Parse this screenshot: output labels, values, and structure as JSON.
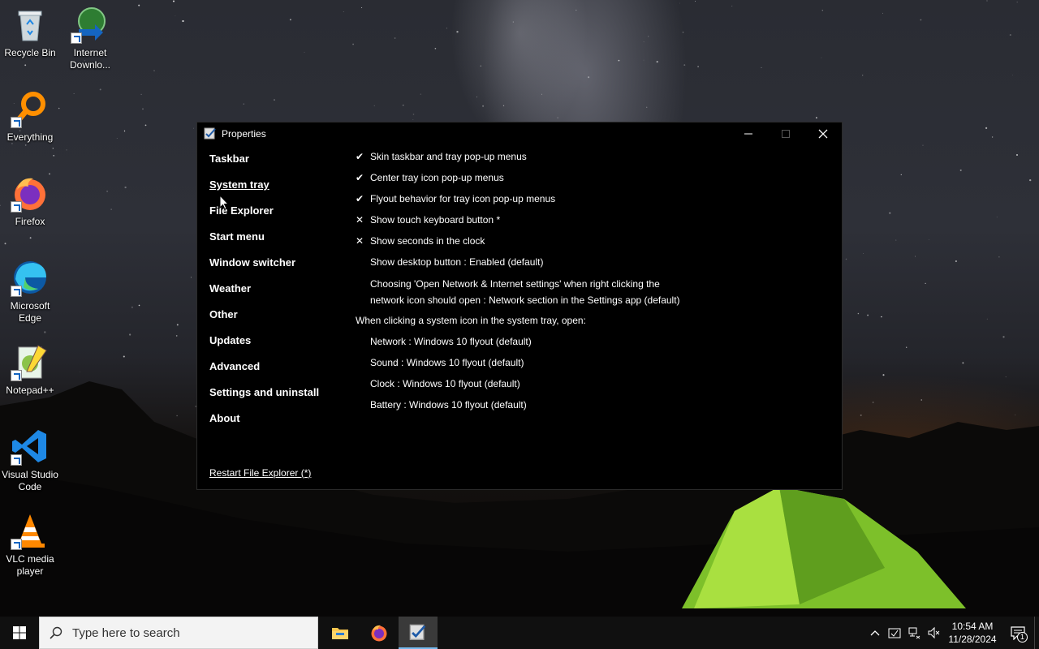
{
  "desktop": {
    "icons": [
      {
        "label": "Recycle Bin",
        "icon": "recycle-bin-icon"
      },
      {
        "label": "Internet Downlo...",
        "icon": "internet-download-manager-icon"
      },
      {
        "label": "Everything",
        "icon": "everything-search-icon"
      },
      {
        "label": "Firefox",
        "icon": "firefox-icon"
      },
      {
        "label": "Microsoft Edge",
        "icon": "edge-icon"
      },
      {
        "label": "Notepad++",
        "icon": "notepad-plus-plus-icon"
      },
      {
        "label": "Visual Studio Code",
        "icon": "vscode-icon"
      },
      {
        "label": "VLC media player",
        "icon": "vlc-icon"
      }
    ]
  },
  "window": {
    "title": "Properties",
    "controls": {
      "minimize": "—",
      "maximize": "☐",
      "close": "✕"
    },
    "nav": [
      "Taskbar",
      "System tray",
      "File Explorer",
      "Start menu",
      "Window switcher",
      "Weather",
      "Other",
      "Updates",
      "Advanced",
      "Settings and uninstall",
      "About"
    ],
    "active_nav": "System tray",
    "restart_link": "Restart File Explorer (*)",
    "settings": [
      {
        "mark": "✔",
        "text": "Skin taskbar and tray pop-up menus"
      },
      {
        "mark": "✔",
        "text": "Center tray icon pop-up menus"
      },
      {
        "mark": "✔",
        "text": "Flyout behavior for tray icon pop-up menus"
      },
      {
        "mark": "✕",
        "text": "Show touch keyboard button *"
      },
      {
        "mark": "✕",
        "text": "Show seconds in the clock"
      },
      {
        "mark": "",
        "text": "Show desktop button : Enabled (default)"
      },
      {
        "mark": "",
        "text": "Choosing 'Open Network & Internet settings' when right clicking the network icon should open : Network section in the Settings app (default)"
      }
    ],
    "section_header": "When clicking a system icon in the system tray, open:",
    "flyouts": [
      "Network : Windows 10 flyout (default)",
      "Sound : Windows 10 flyout (default)",
      "Clock : Windows 10 flyout (default)",
      "Battery : Windows 10 flyout (default)"
    ]
  },
  "taskbar": {
    "search_placeholder": "Type here to search",
    "apps": [
      "file-explorer-icon",
      "firefox-icon",
      "properties-app-icon"
    ],
    "active_app": "properties-app-icon",
    "clock": {
      "time": "10:54 AM",
      "date": "11/28/2024"
    },
    "notification_count": "1"
  },
  "colors": {
    "accent": "#76b9ed",
    "window_bg": "#000000",
    "taskbar_bg": "#101010"
  }
}
